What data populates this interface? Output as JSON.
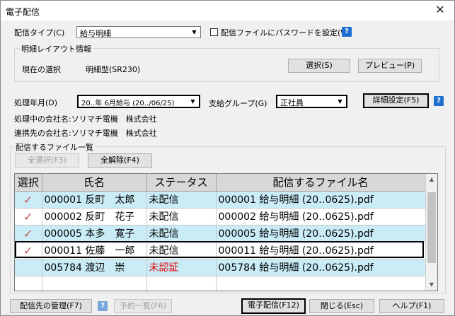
{
  "window": {
    "title": "電子配信",
    "close_glyph": "✕"
  },
  "settings": {
    "delivery_type_label": "配信タイプ(C)",
    "delivery_type_value": "給与明細",
    "password_checkbox_label": "配信ファイルにパスワードを設定(W)",
    "password_checked": false
  },
  "layout_group": {
    "title": "明細レイアウト情報",
    "current_label": "現在の選択",
    "current_value": "明細型(SR230)",
    "select_button": "選択(S)",
    "preview_button": "プレビュー(P)"
  },
  "processing": {
    "year_month_label": "処理年月(D)",
    "year_month_value": "20‥年 6月給与 (20‥/06/25)",
    "pay_group_label": "支給グループ(G)",
    "pay_group_value": "正社員",
    "detail_button": "詳細設定(F5)"
  },
  "company": {
    "processing_label": "処理中の会社名:ソリマチ電機　株式会社",
    "linked_label": "連携先の会社名:ソリマチ電機　株式会社"
  },
  "files_group": {
    "title": "配信するファイル一覧",
    "select_all": "全選択(F3)",
    "deselect_all": "全解除(F4)",
    "columns": [
      "選択",
      "氏名",
      "ステータス",
      "配信するファイル名"
    ],
    "rows": [
      {
        "selected": "✓",
        "name": "000001 反町　太郎",
        "status": "未配信",
        "file": "000001 給与明細 (20‥0625).pdf",
        "error": false
      },
      {
        "selected": "✓",
        "name": "000002 反町　花子",
        "status": "未配信",
        "file": "000002 給与明細 (20‥0625).pdf",
        "error": false
      },
      {
        "selected": "✓",
        "name": "000005 本多　寛子",
        "status": "未配信",
        "file": "000005 給与明細 (20‥0625).pdf",
        "error": false
      },
      {
        "selected": "✓",
        "name": "000011 佐藤　一郎",
        "status": "未配信",
        "file": "000011 給与明細 (20‥0625).pdf",
        "error": false
      },
      {
        "selected": "",
        "name": "005784 渡辺　崇",
        "status": "未認証",
        "file": "005784 給与明細 (20‥0625).pdf",
        "error": true
      },
      {
        "selected": "",
        "name": "",
        "status": "",
        "file": "",
        "error": false
      }
    ]
  },
  "footer": {
    "manage_button": "配信先の管理(F7)",
    "schedule_button": "予約一覧(F6)",
    "send_button": "電子配信(F12)",
    "close_button": "閉じる(Esc)",
    "help_button": "ヘルプ(F1)"
  },
  "icons": {
    "help": "?",
    "dropdown": "▼",
    "scroll_up": "▲",
    "scroll_down": "▼"
  },
  "colors": {
    "row_alt": "#c9ecf7",
    "error": "#e60000",
    "check": "#c0504d",
    "help": "#1e6fd0"
  }
}
